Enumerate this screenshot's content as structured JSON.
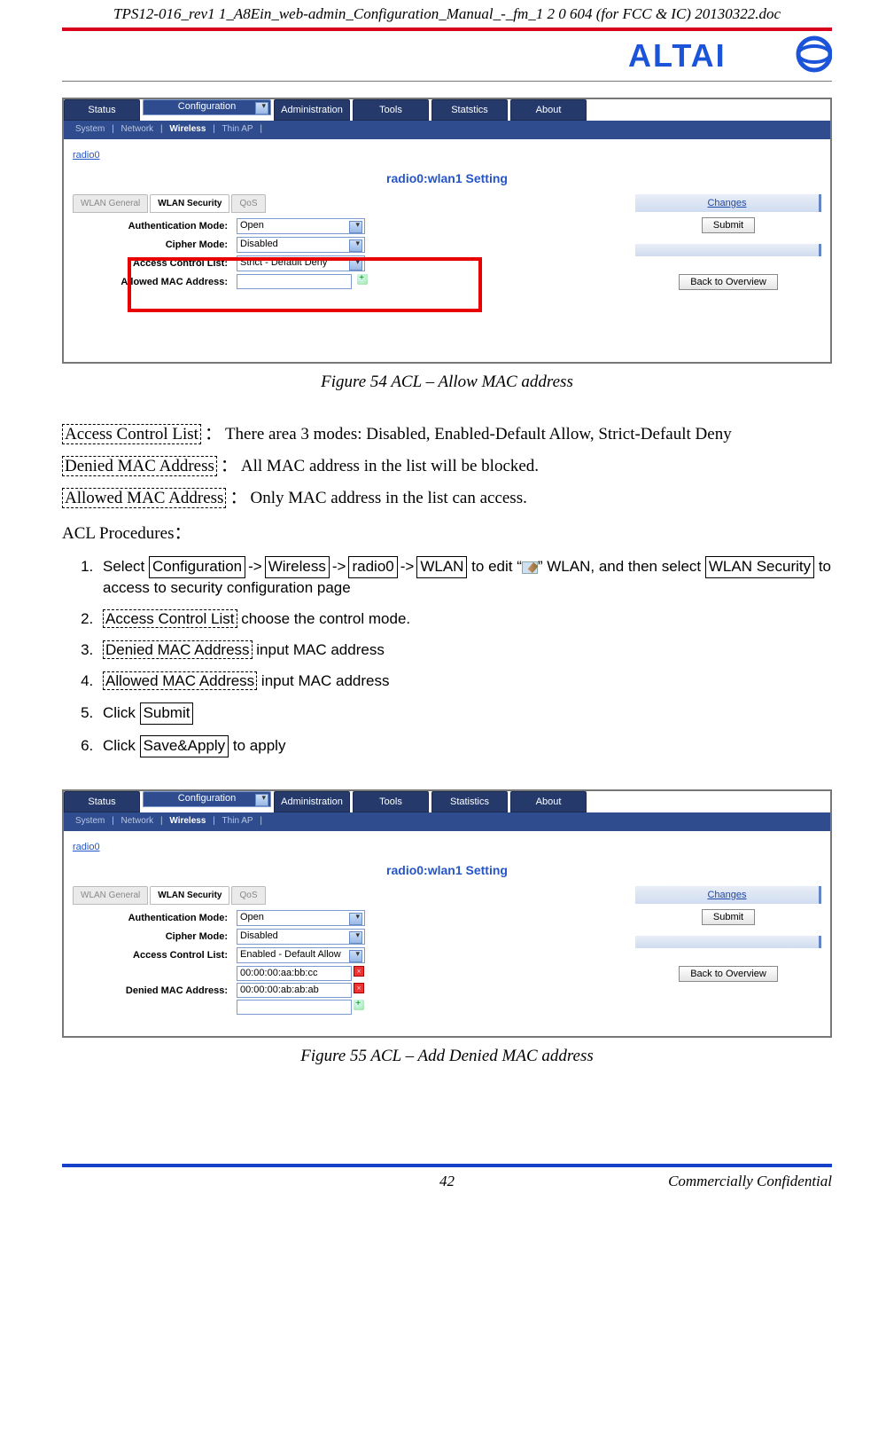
{
  "doc_header": "TPS12-016_rev1 1_A8Ein_web-admin_Configuration_Manual_-_fm_1 2 0 604 (for FCC & IC) 20130322.doc",
  "logo_text": "ALTAI",
  "fig54": {
    "navtabs": [
      "Status",
      "Configuration",
      "Administration",
      "Tools",
      "Statstics",
      "About"
    ],
    "navtab_selected_index": 1,
    "subnav": [
      "System",
      "Network",
      "Wireless",
      "Thin AP"
    ],
    "subnav_selected_index": 2,
    "crumb": "radio0",
    "section_title": "radio0:wlan1 Setting",
    "subtabs": [
      "WLAN General",
      "WLAN Security",
      "QoS"
    ],
    "subtabs_selected_index": 1,
    "rows": {
      "auth_label": "Authentication Mode:",
      "auth_value": "Open",
      "cipher_label": "Cipher Mode:",
      "cipher_value": "Disabled",
      "acl_label": "Access Control List:",
      "acl_value": "Strict - Default Deny",
      "allowed_label": "Allowed MAC Address:",
      "allowed_value": ""
    },
    "side": {
      "changes": "Changes",
      "submit": "Submit",
      "back": "Back to Overview"
    },
    "caption": "Figure 54 ACL – Allow MAC address"
  },
  "defs": {
    "acl_term": "Access Control List",
    "acl_desc": "There area 3 modes: Disabled, Enabled-Default Allow, Strict-Default Deny",
    "denied_term": "Denied MAC Address",
    "denied_desc": "All MAC address in the list will be blocked.",
    "allowed_term": "Allowed MAC Address",
    "allowed_desc": "Only MAC address in the list can access.",
    "proc_head": "ACL Procedures："
  },
  "steps": {
    "s1_pre": "Select ",
    "s1_b1": "Configuration",
    "s1_b2": "Wireless",
    "s1_b3": "radio0",
    "s1_b4": "WLAN",
    "s1_mid": " to edit   “",
    "s1_mid2": "”   WLAN, and then select ",
    "s1_b5": "WLAN Security",
    "s1_post": " to access to security configuration page",
    "s2_b": "Access Control List",
    "s2_t": " choose the control mode.",
    "s3_b": "Denied MAC Address",
    "s3_t": " input MAC address",
    "s4_b": "Allowed MAC Address",
    "s4_t": " input MAC address",
    "s5_pre": "Click ",
    "s5_b": "Submit",
    "s6_pre": "Click ",
    "s6_b": "Save&Apply",
    "s6_post": " to apply",
    "arrow": "->"
  },
  "fig55": {
    "navtabs": [
      "Status",
      "Configuration",
      "Administration",
      "Tools",
      "Statistics",
      "About"
    ],
    "navtab_selected_index": 1,
    "subnav": [
      "System",
      "Network",
      "Wireless",
      "Thin AP"
    ],
    "subnav_selected_index": 2,
    "crumb": "radio0",
    "section_title": "radio0:wlan1 Setting",
    "subtabs": [
      "WLAN General",
      "WLAN Security",
      "QoS"
    ],
    "subtabs_selected_index": 1,
    "rows": {
      "auth_label": "Authentication Mode:",
      "auth_value": "Open",
      "cipher_label": "Cipher Mode:",
      "cipher_value": "Disabled",
      "acl_label": "Access Control List:",
      "acl_value": "Enabled - Default Allow",
      "denied_label": "Denied MAC Address:",
      "mac1": "00:00:00:aa:bb:cc",
      "mac2": "00:00:00:ab:ab:ab",
      "mac3": ""
    },
    "side": {
      "changes": "Changes",
      "submit": "Submit",
      "back": "Back to Overview"
    },
    "caption": "Figure 55 ACL – Add Denied MAC address"
  },
  "footer": {
    "page_num": "42",
    "conf": "Commercially Confidential"
  }
}
